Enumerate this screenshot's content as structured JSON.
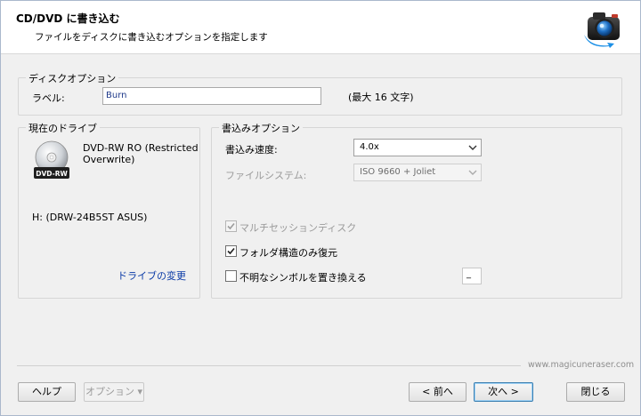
{
  "header": {
    "title": "CD/DVD に書き込む",
    "subtitle": "ファイルをディスクに書き込むオプションを指定します"
  },
  "disc_options": {
    "legend": "ディスクオプション",
    "label_caption": "ラベル:",
    "label_value": "Burn",
    "max_hint": "(最大 16 文字)"
  },
  "current_drive": {
    "legend": "現在のドライブ",
    "disc_badge": "DVD-RW",
    "drive_type": "DVD-RW RO (Restricted Overwrite)",
    "drive_name": "H: (DRW-24B5ST ASUS)",
    "change_link": "ドライブの変更"
  },
  "write_options": {
    "legend": "書込みオプション",
    "speed_label": "書込み速度:",
    "speed_value": "4.0x",
    "fs_label": "ファイルシステム:",
    "fs_value": "ISO 9660 + Joliet",
    "multisession_label": "マルチセッションディスク",
    "multisession_checked": true,
    "multisession_enabled": false,
    "folder_only_label": "フォルダ構造のみ復元",
    "folder_only_checked": true,
    "replace_symbols_label": "不明なシンボルを置き換える",
    "replace_symbols_checked": false,
    "replace_char": "_"
  },
  "footer": {
    "website": "www.magicuneraser.com",
    "help": "ヘルプ",
    "options": "オプション ▾",
    "back": "< 前へ",
    "next": "次へ >",
    "close": "閉じる"
  },
  "colors": {
    "link": "#0a3aa6",
    "default_button_border": "#3c7fb1"
  }
}
